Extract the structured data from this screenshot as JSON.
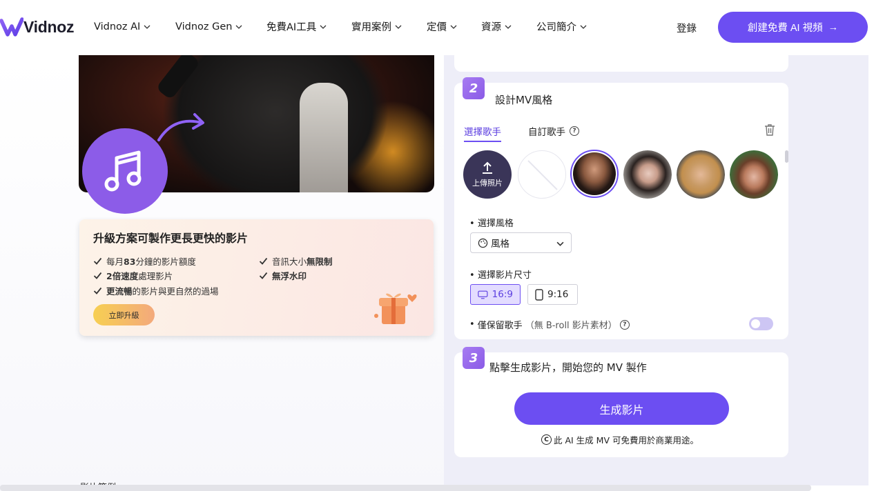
{
  "nav": {
    "brand": "Vidnoz",
    "items": [
      "Vidnoz AI",
      "Vidnoz Gen",
      "免費AI工具",
      "實用案例",
      "定價",
      "資源",
      "公司簡介"
    ],
    "login": "登錄",
    "cta": "創建免費 AI 視頻",
    "cta_arrow": "→"
  },
  "upgrade": {
    "title": "升級方案可製作更長更快的影片",
    "features": [
      {
        "pre": "每月",
        "bold": "83",
        "post": "分鐘的影片額度"
      },
      {
        "pre": "音訊大小",
        "bold": "無限制",
        "post": ""
      },
      {
        "pre": "",
        "bold": "2倍速度",
        "post": "處理影片"
      },
      {
        "pre": "",
        "bold": "無浮水印",
        "post": ""
      },
      {
        "pre": "",
        "bold": "更流暢",
        "post": "的影片與更自然的過場"
      }
    ],
    "button": "立即升級"
  },
  "bottom_left_text": "影片範例",
  "step2": {
    "badge": "2",
    "title": "設計MV風格",
    "tab_select_singer": "選擇歌手",
    "tab_custom_singer": "自訂歌手",
    "upload_label": "上傳照片",
    "style_label": "選擇風格",
    "style_value": "風格",
    "size_label": "選擇影片尺寸",
    "ratio_169": "16:9",
    "ratio_916": "9:16",
    "keep_singer_label": "僅保留歌手",
    "keep_singer_note": "（無 B-roll 影片素材）",
    "toggle_on": false
  },
  "step3": {
    "badge": "3",
    "title": "點擊生成影片，開始您的 MV 製作",
    "button": "生成影片",
    "note": "此 AI 生成 MV 可免費用於商業用途。"
  },
  "colors": {
    "accent": "#6c4ef2",
    "badge": "#8a5ae6",
    "panel_bg": "#eeeef8"
  }
}
